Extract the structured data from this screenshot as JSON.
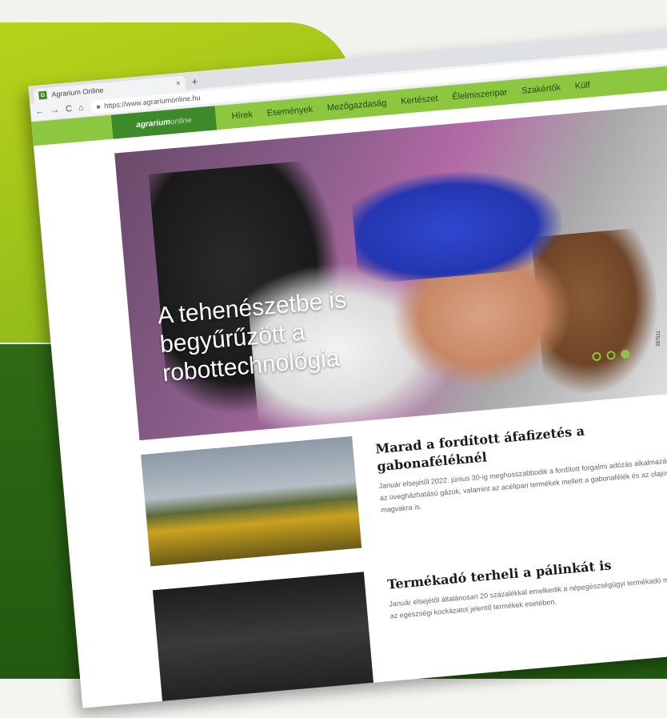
{
  "browser": {
    "tab_title": "Agrarium Online",
    "tab_close": "×",
    "new_tab": "+",
    "url": "https://www.agrariumonline.hu",
    "nav": {
      "back": "←",
      "forward": "→",
      "reload": "C",
      "home": "⌂",
      "lock": "🔒"
    }
  },
  "site": {
    "logo_main": "agrarium",
    "logo_sub": "online",
    "menu": [
      "Hírek",
      "Események",
      "Mezőgazdaság",
      "Kertészet",
      "Élelmiszeripar",
      "Szakértők",
      "Külf"
    ]
  },
  "hero": {
    "title": "A tehenészetbe is begyűrűzött a robottechnológia"
  },
  "articles": [
    {
      "title": "Marad a fordított áfafizetés a gabonaféléknél",
      "text": "Január elsejétől 2022. június 30-ig meghosszabbodik a fordított forgalmi adózás alkalmazása az üvegházhatású gázok, valamint az acélipari termékek mellett a gabonafélék és az olajos magvakra is."
    },
    {
      "title": "Termékadó terheli a pálinkát is",
      "text": "Január elsejétől általánosan 20 százalékkal emelkedik a népegészségügyi termékadó mértéke az egészségi kockázatot jelentő termékek esetében."
    }
  ],
  "side_code": "287511",
  "colors": {
    "lime": "#9cc21a",
    "dark_green": "#2f6a14",
    "nav_green": "#8dc63f",
    "logo_green": "#3d8a2a"
  }
}
